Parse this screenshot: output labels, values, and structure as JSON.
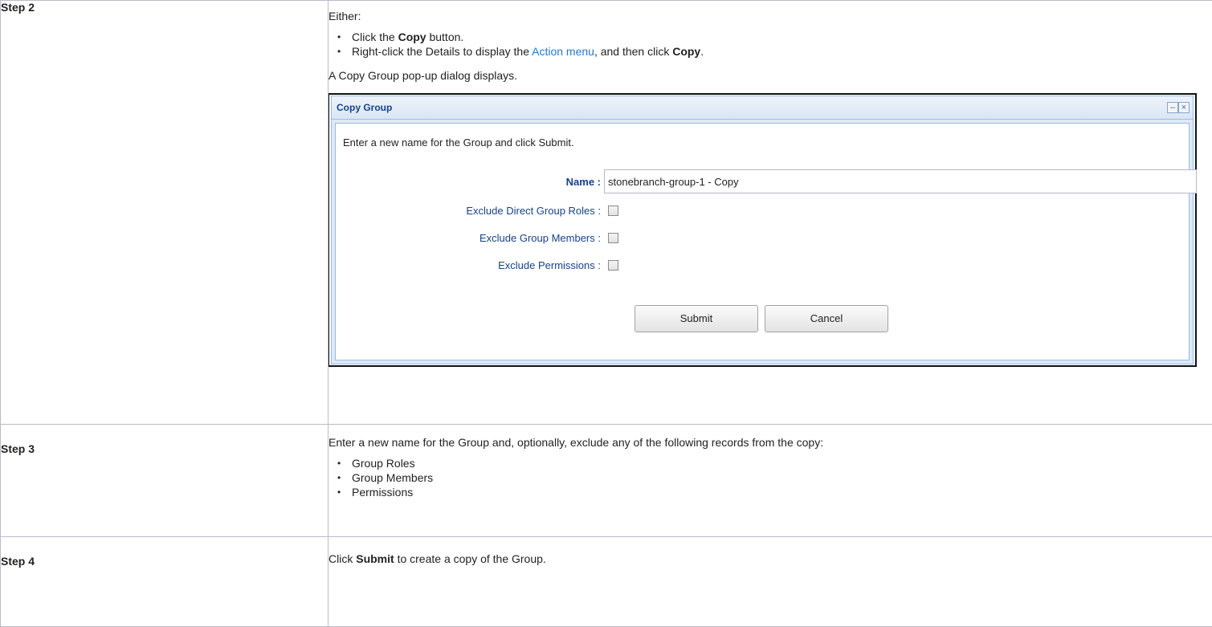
{
  "steps": [
    {
      "label": "Step 2",
      "intro": "Either:",
      "bullets": [
        {
          "pre": "Click the ",
          "bold": "Copy",
          "post": " button."
        },
        {
          "pre": "Right-click the Details to display the ",
          "link": "Action menu",
          "mid": ", and then click ",
          "bold": "Copy",
          "post": "."
        }
      ],
      "after": "A Copy Group pop-up dialog displays."
    },
    {
      "label": "Step 3",
      "intro": "Enter a new name for the Group and, optionally, exclude any of the following records from the copy:",
      "bullets": [
        "Group Roles",
        "Group Members",
        "Permissions"
      ]
    },
    {
      "label": "Step 4",
      "pre": "Click ",
      "bold": "Submit",
      "post": " to create a copy of the Group."
    }
  ],
  "dialog": {
    "title": "Copy Group",
    "minimize_glyph": "–",
    "close_glyph": "×",
    "intro": "Enter a new name for the Group and click Submit.",
    "name_label": "Name :",
    "name_value": "stonebranch-group-1 - Copy",
    "exclude_roles_label": "Exclude Direct Group Roles :",
    "exclude_members_label": "Exclude Group Members :",
    "exclude_permissions_label": "Exclude Permissions :",
    "submit_label": "Submit",
    "cancel_label": "Cancel"
  }
}
